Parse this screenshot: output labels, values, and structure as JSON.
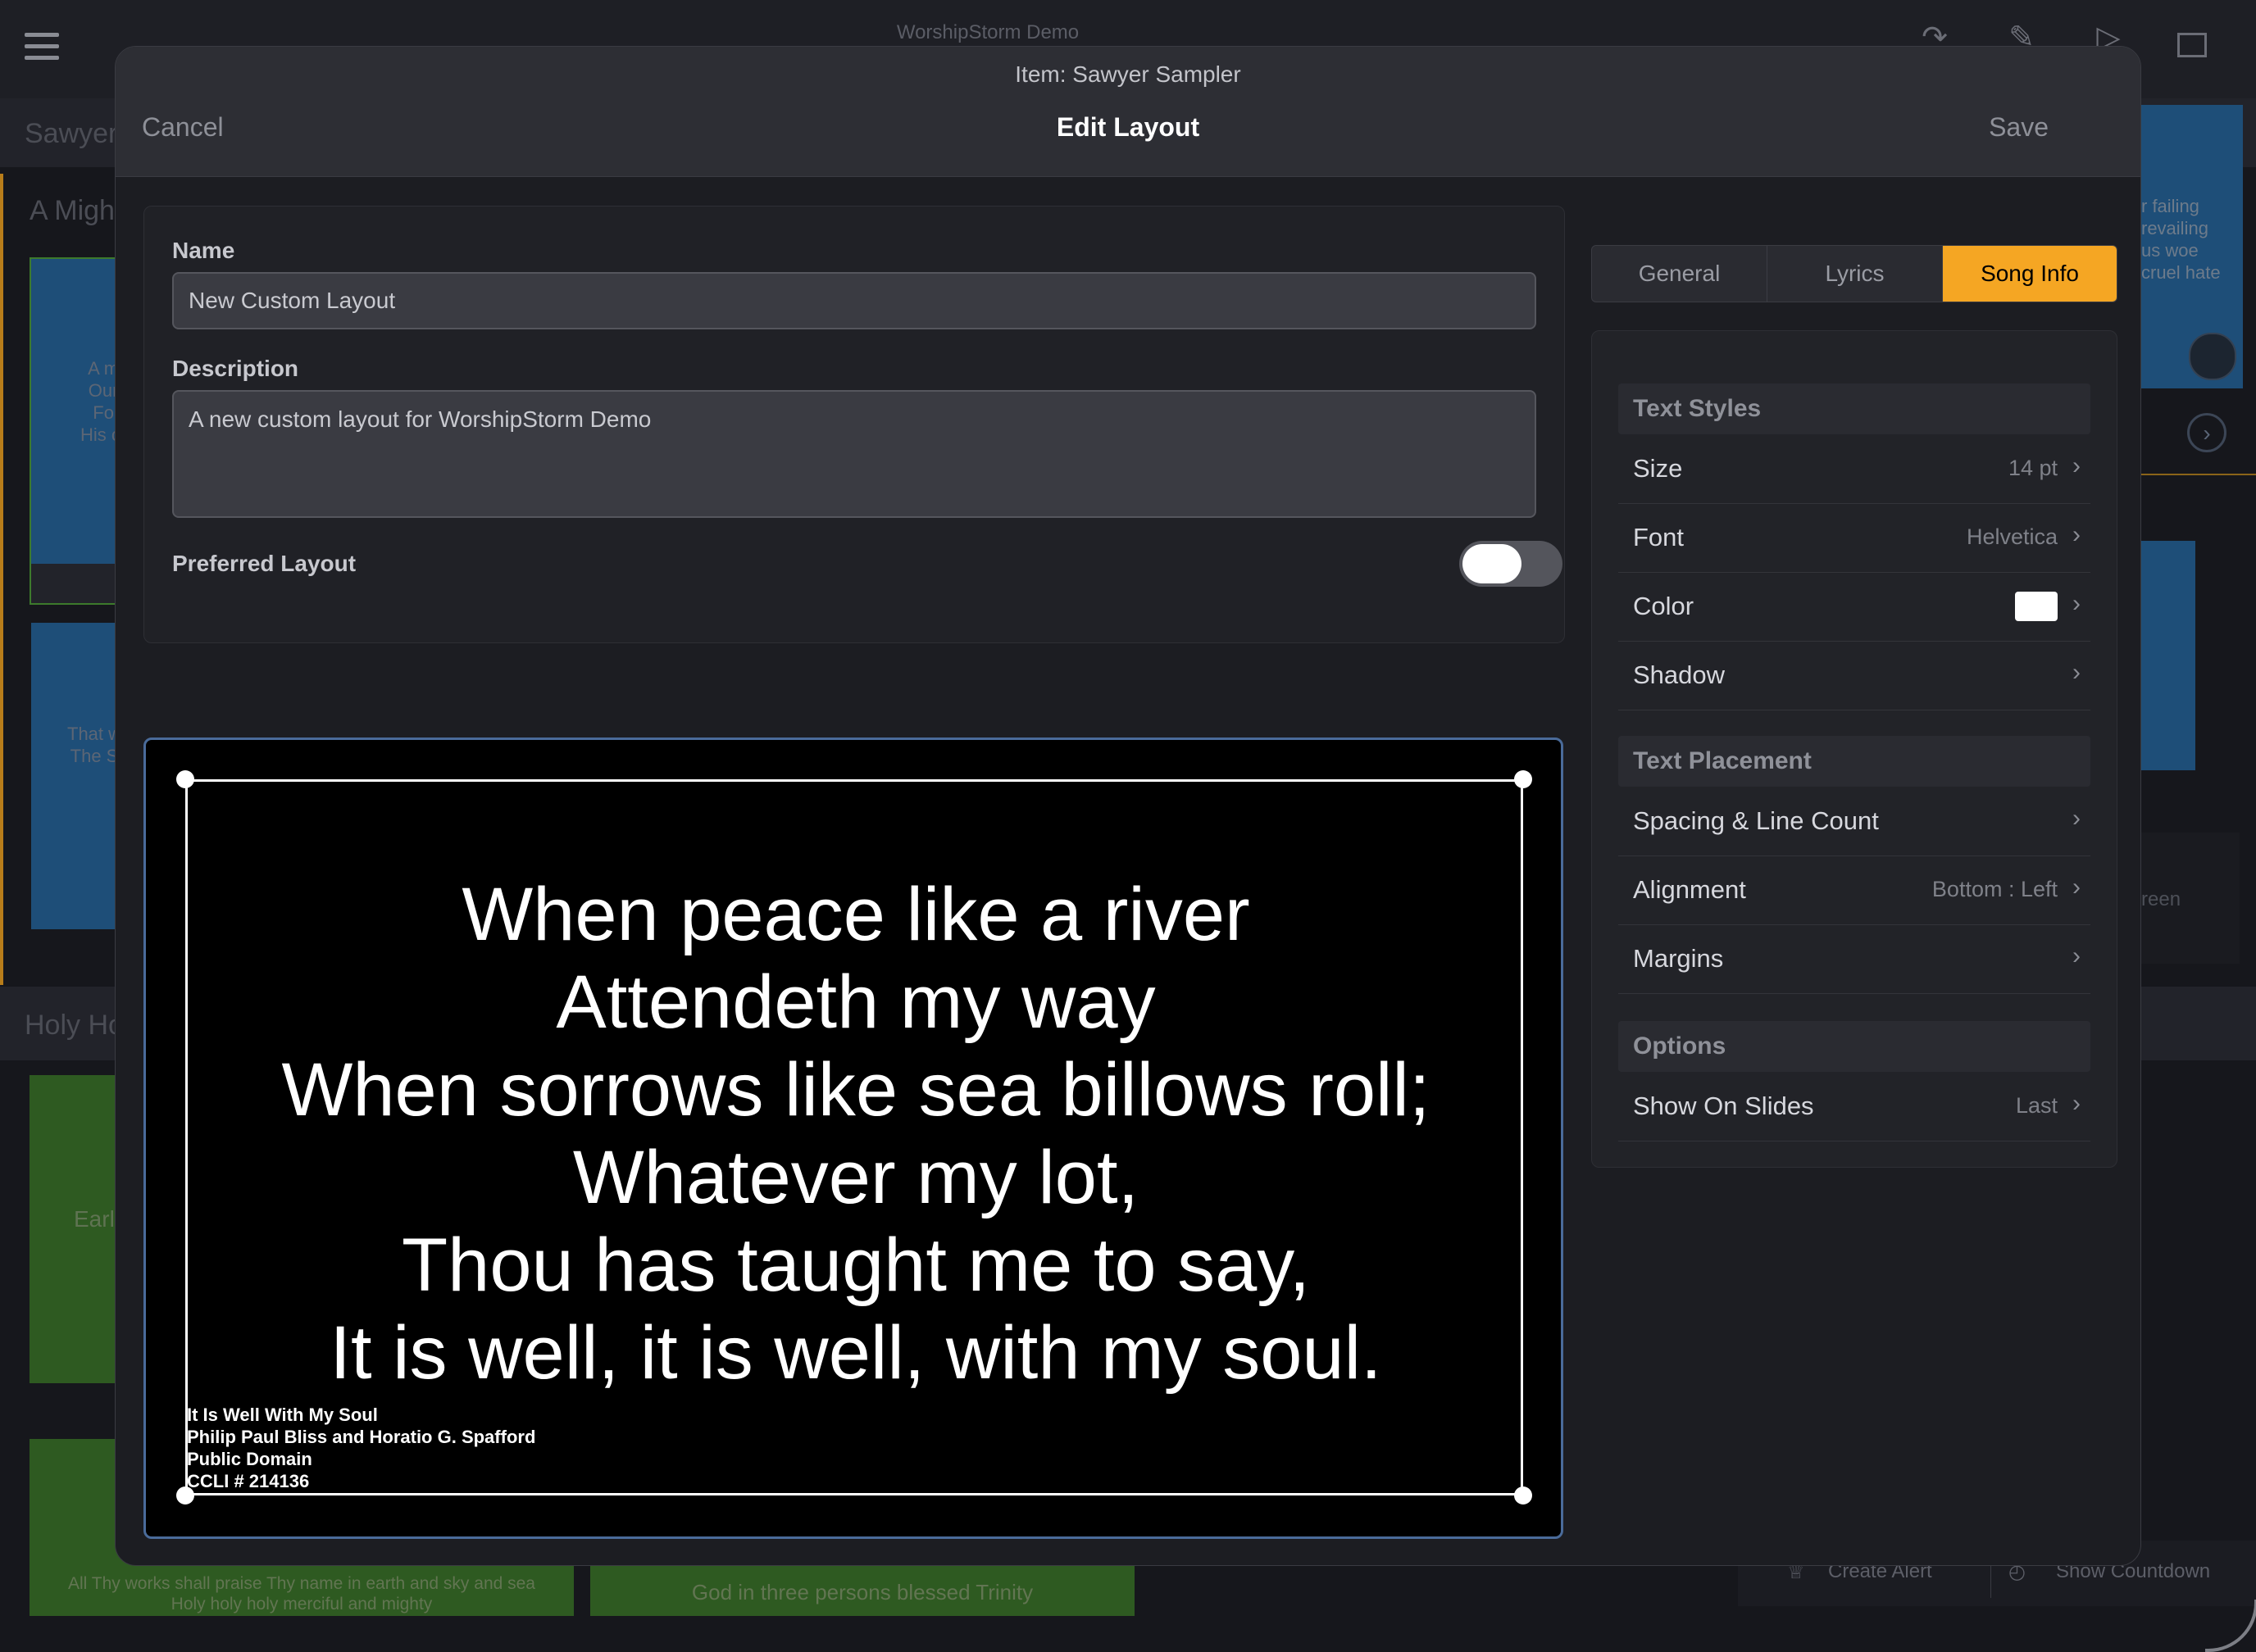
{
  "app": {
    "title": "WorshipStorm Demo",
    "section_sawyer": "Sawyer",
    "section_mighty": "A Migh",
    "section_holy": "Holy Ho",
    "slide1_text": "A m\nOur\nFo\nHis cr",
    "slide2_text": "That w\nThe S",
    "slide3_text": "Earl",
    "right_slide_text": "r failing\nrevailing\nus woe\ncruel hate",
    "right_screen_text": "reen",
    "bottom_slide1_text": "All Thy works shall praise Thy name in earth and sky and sea\nHoly holy holy merciful and mighty",
    "bottom_slide2_text": "God in three persons blessed Trinity",
    "create_alert": "Create Alert",
    "show_countdown": "Show Countdown"
  },
  "modal": {
    "item_title": "Item: Sawyer Sampler",
    "title": "Edit Layout",
    "cancel": "Cancel",
    "save": "Save"
  },
  "form": {
    "name_label": "Name",
    "name_value": "New Custom Layout",
    "description_label": "Description",
    "description_value": "A new custom layout for WorshipStorm Demo",
    "preferred_label": "Preferred Layout",
    "preferred_on": false
  },
  "preview": {
    "lyrics": "When peace like a river\nAttendeth my way\nWhen sorrows like sea billows roll;\nWhatever my lot,\nThou has taught me to say,\nIt is well, it is well, with my soul.",
    "song_info": "It Is Well With My Soul\nPhilip Paul Bliss and Horatio G. Spafford\nPublic Domain\nCCLI # 214136"
  },
  "tabs": [
    {
      "label": "General",
      "selected": false
    },
    {
      "label": "Lyrics",
      "selected": false
    },
    {
      "label": "Song Info",
      "selected": true
    }
  ],
  "settings": {
    "text_styles": {
      "title": "Text Styles",
      "size_label": "Size",
      "size_value": "14 pt",
      "font_label": "Font",
      "font_value": "Helvetica",
      "color_label": "Color",
      "color_value": "#ffffff",
      "shadow_label": "Shadow"
    },
    "text_placement": {
      "title": "Text Placement",
      "spacing_label": "Spacing & Line Count",
      "alignment_label": "Alignment",
      "alignment_value": "Bottom : Left",
      "margins_label": "Margins"
    },
    "options": {
      "title": "Options",
      "show_label": "Show On Slides",
      "show_value": "Last"
    }
  },
  "colors": {
    "accent": "#f5a623",
    "preview_border": "#4a6b9a",
    "blue_slide": "#1f4f7a",
    "green_slide": "#2f5a22"
  }
}
